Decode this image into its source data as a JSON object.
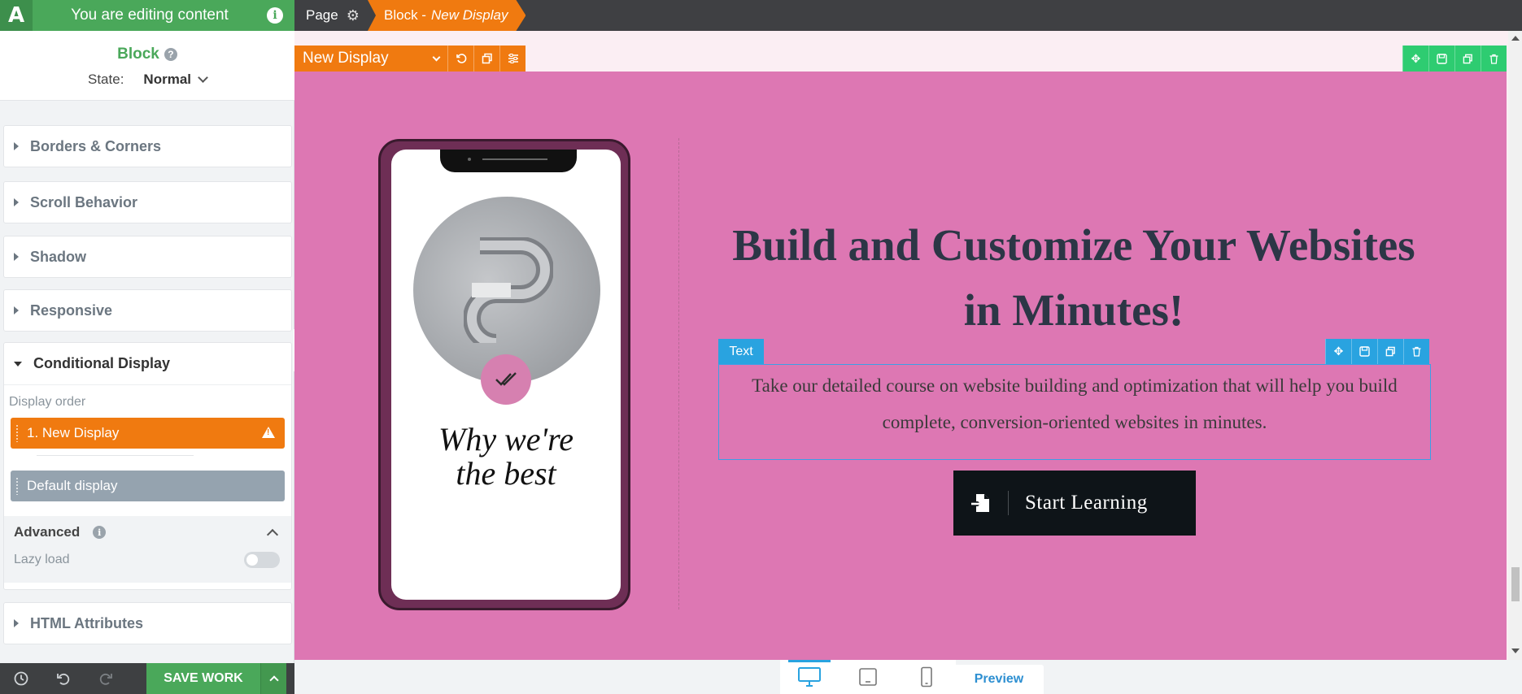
{
  "sidebar": {
    "header_title": "You are editing content",
    "logo_text": "A",
    "block_title": "Block",
    "state_label": "State:",
    "state_value": "Normal",
    "sections": [
      {
        "label": "Borders & Corners"
      },
      {
        "label": "Scroll Behavior"
      },
      {
        "label": "Shadow"
      },
      {
        "label": "Responsive"
      }
    ],
    "conditional": {
      "title": "Conditional Display",
      "order_label": "Display order",
      "items": [
        {
          "label": "1.  New Display"
        },
        {
          "label": "Default display"
        }
      ],
      "advanced_title": "Advanced",
      "lazy_label": "Lazy load"
    },
    "html_attributes": "HTML Attributes",
    "footer": {
      "save_label": "SAVE WORK"
    }
  },
  "topbar": {
    "page_label": "Page",
    "block_label": "Block -",
    "block_name": "New Display"
  },
  "canvas": {
    "toolbar_label": "New Display",
    "phone_text_line1": "Why we're",
    "phone_text_line2": "the best",
    "heading_line1": "Build and Customize Your Websites",
    "heading_line2": "in Minutes!",
    "text_tag": "Text",
    "paragraph_line1": "Take our detailed course on website building and optimization that will help you build",
    "paragraph_line2": "complete, conversion-oriented websites in minutes.",
    "cta_label": "Start Learning"
  },
  "bottom": {
    "preview_label": "Preview"
  },
  "colors": {
    "brand_green": "#4aa85a",
    "accent_orange": "#f07a10",
    "canvas_pink": "#dd77b3",
    "text_blue": "#29a3e0"
  }
}
